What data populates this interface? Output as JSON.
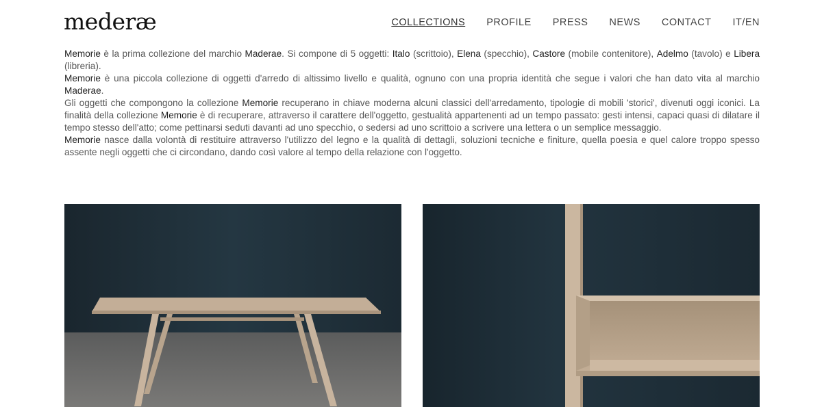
{
  "logo": {
    "text": "mederæ"
  },
  "nav": {
    "items": [
      {
        "label": "COLLECTIONS",
        "active": true
      },
      {
        "label": "PROFILE"
      },
      {
        "label": "PRESS"
      },
      {
        "label": "NEWS"
      },
      {
        "label": "CONTACT"
      },
      {
        "label": "IT/EN"
      }
    ]
  },
  "intro": {
    "p1": {
      "s1": "Memorie",
      "t1": " è la prima collezione del marchio ",
      "s2": "Maderae",
      "t2": ". Si compone di 5 oggetti: ",
      "s3": "Italo",
      "t3": " (scrittoio), ",
      "s4": "Elena",
      "t4": " (specchio), ",
      "s5": "Castore",
      "t5": " (mobile contenitore), ",
      "s6": "Adelmo",
      "t6": " (tavolo) e ",
      "s7": "Libera",
      "t7": " (libreria)."
    },
    "p2": {
      "s1": "Memorie",
      "t1": " è una piccola collezione di oggetti d'arredo di altissimo livello e qualità, ognuno con una propria identità che segue i valori che han dato vita al marchio ",
      "s2": "Maderae",
      "t2": "."
    },
    "p3": {
      "t1": "Gli oggetti che compongono la collezione ",
      "s1": "Memorie",
      "t2": " recuperano in chiave moderna alcuni classici dell'arredamento, tipologie di mobili 'storici', divenuti oggi iconici. La finalità della collezione ",
      "s2": "Memorie",
      "t3": " è di recuperare, attraverso il carattere dell'oggetto, gestualità appartenenti ad un tempo passato: gesti intensi, capaci quasi di dilatare il tempo stesso dell'atto; come pettinarsi seduti davanti ad uno specchio, o sedersi ad uno scrittoio a scrivere una lettera o un semplice messaggio."
    },
    "p4": {
      "s1": "Memorie",
      "t1": " nasce dalla volontà di restituire attraverso l'utilizzo del legno e la qualità di dettagli, soluzioni tecniche e finiture, quella poesia e quel calore troppo spesso assente negli oggetti che ci circondano, dando così valore al tempo della relazione con l'oggetto."
    }
  },
  "colors": {
    "wall": "#1f2d36",
    "floor": "#6b6a67",
    "wood": "#c9b59e"
  }
}
